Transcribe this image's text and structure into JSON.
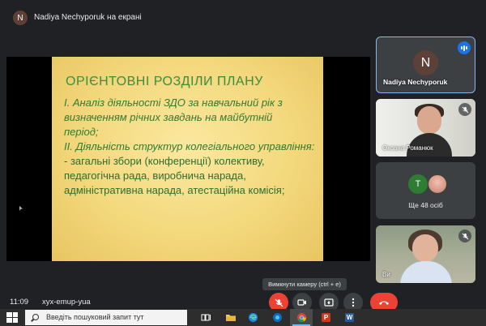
{
  "top_bar": {
    "presenter_initial": "N",
    "presenter_label": "Nadiya Nechyporuk на екрані"
  },
  "slide": {
    "title": "ОРІЄНТОВНІ РОЗДІЛИ ПЛАНУ",
    "lines": [
      "І. Аналіз діяльності ЗДО за навчальний рік з",
      "визначенням річних завдань на майбутній",
      "період;",
      "ІІ. Діяльність структур колегіального управління:",
      "- загальні збори (конференції) колективу,",
      "педагогічна рада, виробнича нарада,",
      "адміністративна нарада, атестаційна комісія;"
    ]
  },
  "participants": {
    "tile1": {
      "initial": "N",
      "name": "Nadiya Nechyporuk"
    },
    "tile2": {
      "name": "Оксана Романюк"
    },
    "tile3": {
      "initial": "T",
      "label": "Ще 48 осіб"
    },
    "tile4": {
      "name": "Ви"
    }
  },
  "controls": {
    "tooltip": "Вимкнути камеру (ctrl + e)",
    "time": "11:09",
    "meeting_code": "xyx-emup-yua"
  },
  "taskbar": {
    "search_placeholder": "Введіть пошуковий запит тут",
    "ppt_letter": "P",
    "word_letter": "W"
  },
  "colors": {
    "accent_blue": "#1a73e8",
    "danger_red": "#ea4335",
    "slide_green": "#2e7d32",
    "slide_bg": "#f3d87c"
  }
}
